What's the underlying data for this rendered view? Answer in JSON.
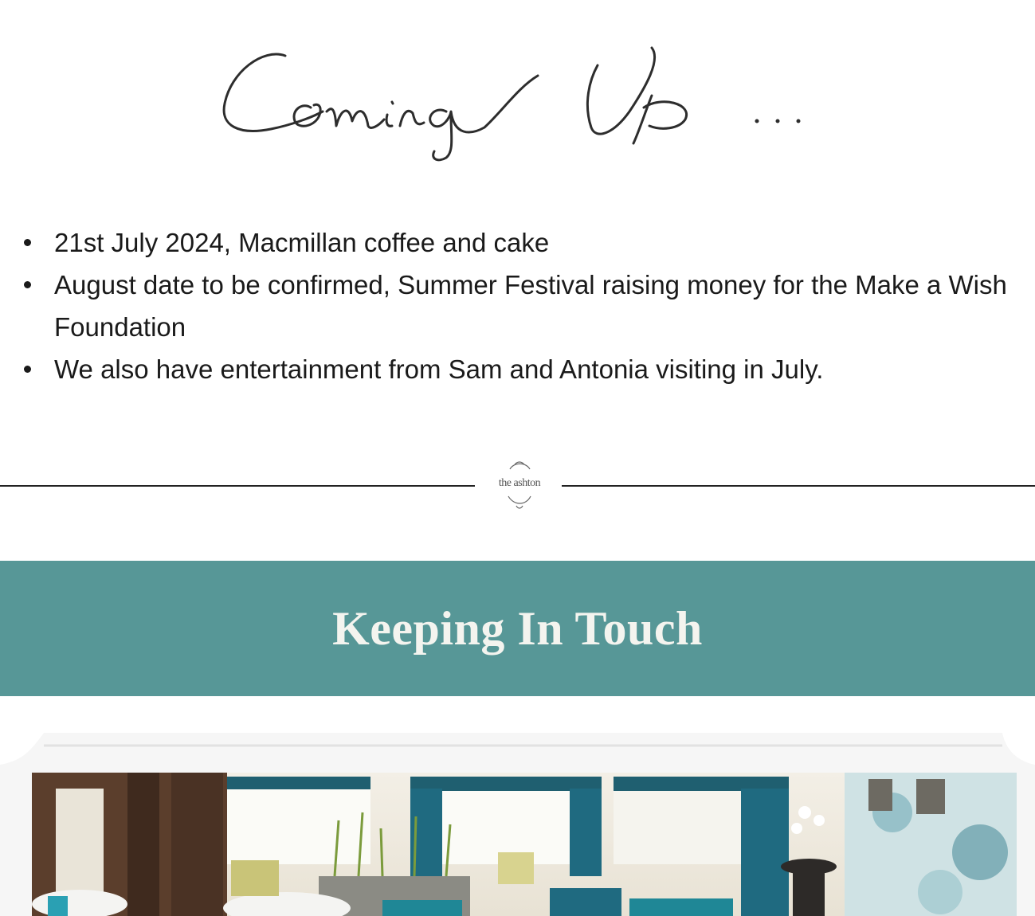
{
  "coming_up": {
    "heading": "Coming Up...",
    "events": [
      "21st July 2024, Macmillan coffee and cake",
      "August date to be confirmed, Summer Festival raising money for the Make a Wish Foundation",
      "We also have entertainment from Sam and Antonia visiting in July."
    ]
  },
  "divider": {
    "logo_text": "the ashton"
  },
  "keeping_in_touch": {
    "title": "Keeping In Touch",
    "accent_color": "#579797"
  },
  "photo": {
    "subject": "lounge-dining-room"
  }
}
